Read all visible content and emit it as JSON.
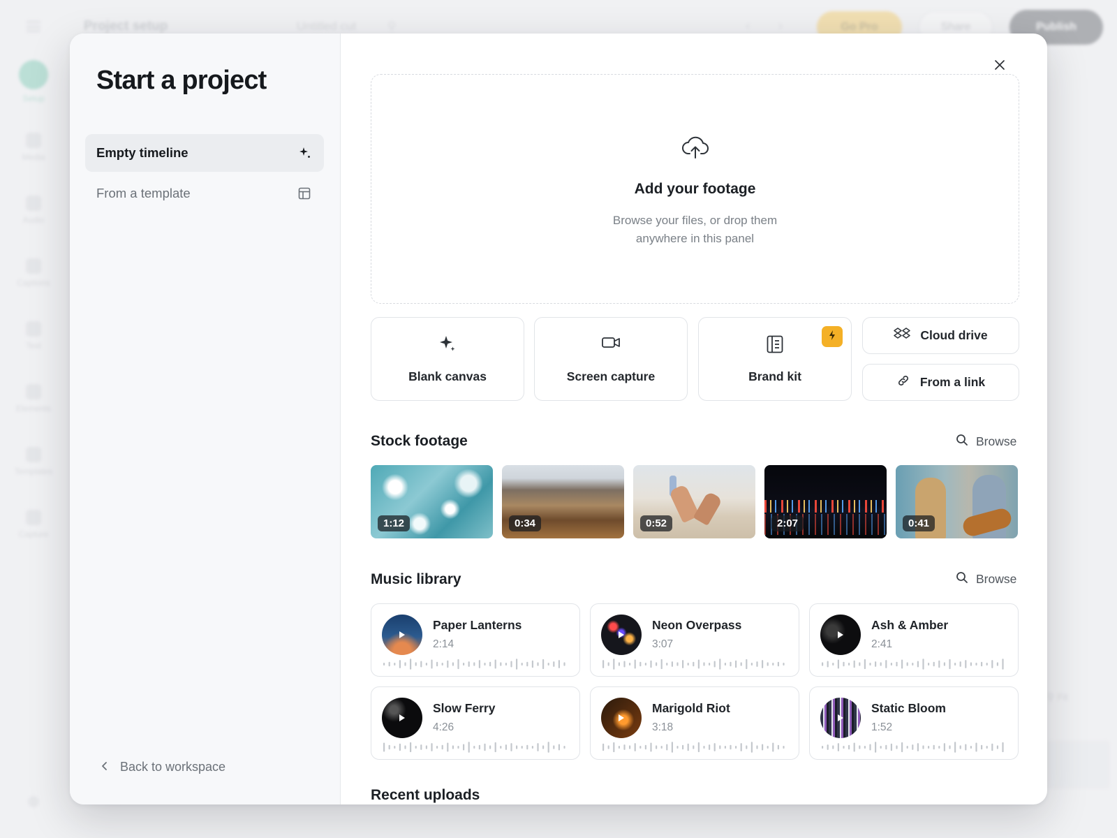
{
  "background": {
    "project_title": "Project setup",
    "cut_name": "Untitled cut",
    "go_pro_label": "Go Pro",
    "share_label": "Share",
    "publish_label": "Publish",
    "rail_items": [
      "Setup",
      "Media",
      "Audio",
      "Captions",
      "Text",
      "Elements",
      "Templates",
      "Capture"
    ],
    "right_fit_label": "Fit"
  },
  "modal": {
    "title": "Start a project",
    "close_icon": "close-icon",
    "sidebar": {
      "items": [
        {
          "label": "Empty timeline",
          "icon": "sparkle-icon",
          "active": true
        },
        {
          "label": "From a template",
          "icon": "template-icon",
          "active": false
        }
      ],
      "back_label": "Back to workspace"
    },
    "dropzone": {
      "icon": "upload-cloud-icon",
      "title": "Add your footage",
      "subtitle_line1": "Browse your files, or drop them",
      "subtitle_line2": "anywhere in this panel"
    },
    "options": [
      {
        "label": "Blank canvas",
        "icon": "sparkle-icon"
      },
      {
        "label": "Screen capture",
        "icon": "video-camera-icon"
      },
      {
        "label": "Brand kit",
        "icon": "brand-book-icon",
        "badge": "lightning-icon"
      }
    ],
    "sources": [
      {
        "label": "Cloud drive",
        "icon": "dropbox-icon"
      },
      {
        "label": "From a link",
        "icon": "link-icon"
      }
    ],
    "stock": {
      "title": "Stock footage",
      "browse_label": "Browse",
      "items": [
        {
          "duration": "1:12",
          "scene": "ocean waves aerial"
        },
        {
          "duration": "0:34",
          "scene": "mountain valley"
        },
        {
          "duration": "0:52",
          "scene": "beach yoga"
        },
        {
          "duration": "2:07",
          "scene": "city skyline night"
        },
        {
          "duration": "0:41",
          "scene": "two men playing guitar"
        }
      ]
    },
    "music": {
      "title": "Music library",
      "browse_label": "Browse",
      "tracks": [
        {
          "name": "Paper Lanterns",
          "time": "2:14"
        },
        {
          "name": "Neon Overpass",
          "time": "3:07"
        },
        {
          "name": "Ash & Amber",
          "time": "2:41"
        },
        {
          "name": "Slow Ferry",
          "time": "4:26"
        },
        {
          "name": "Marigold Riot",
          "time": "3:18"
        },
        {
          "name": "Static Bloom",
          "time": "1:52"
        }
      ]
    },
    "recent_title": "Recent uploads"
  },
  "colors": {
    "accent_badge": "#f4b026",
    "primary_dark": "#3c4148",
    "go_pro": "#f6c343",
    "active_rail": "#5fc3a6"
  }
}
